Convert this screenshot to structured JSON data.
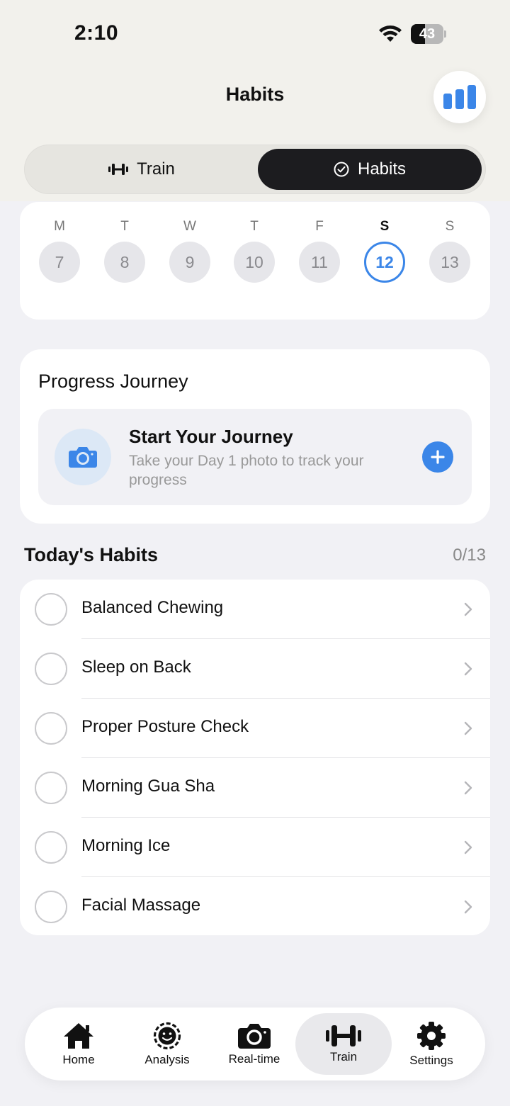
{
  "status_bar": {
    "time": "2:10",
    "battery": "43",
    "battery_level": 0.43
  },
  "header": {
    "title": "Habits",
    "stats_icon": "bar-chart-icon"
  },
  "segment": {
    "train_label": "Train",
    "habits_label": "Habits",
    "selected": "Habits"
  },
  "week": {
    "days": [
      {
        "letter": "M",
        "date": "7"
      },
      {
        "letter": "T",
        "date": "8"
      },
      {
        "letter": "W",
        "date": "9"
      },
      {
        "letter": "T",
        "date": "10"
      },
      {
        "letter": "F",
        "date": "11"
      },
      {
        "letter": "S",
        "date": "12",
        "selected": true
      },
      {
        "letter": "S",
        "date": "13"
      }
    ]
  },
  "progress": {
    "title": "Progress Journey",
    "card_title": "Start Your Journey",
    "card_subtitle": "Take your Day 1 photo to track your progress"
  },
  "habits": {
    "title": "Today's Habits",
    "count": "0/13",
    "items": [
      {
        "name": "Balanced Chewing"
      },
      {
        "name": "Sleep on Back"
      },
      {
        "name": "Proper Posture Check"
      },
      {
        "name": "Morning Gua Sha"
      },
      {
        "name": "Morning Ice"
      },
      {
        "name": "Facial Massage"
      }
    ]
  },
  "tabs": [
    {
      "label": "Home",
      "icon": "home-icon"
    },
    {
      "label": "Analysis",
      "icon": "face-scan-icon"
    },
    {
      "label": "Real-time",
      "icon": "camera-icon"
    },
    {
      "label": "Train",
      "icon": "dumbbell-icon",
      "active": true
    },
    {
      "label": "Settings",
      "icon": "gear-icon"
    }
  ],
  "colors": {
    "accent": "#3b86e8",
    "dark": "#1c1c1f",
    "background": "#f1f1f5"
  }
}
